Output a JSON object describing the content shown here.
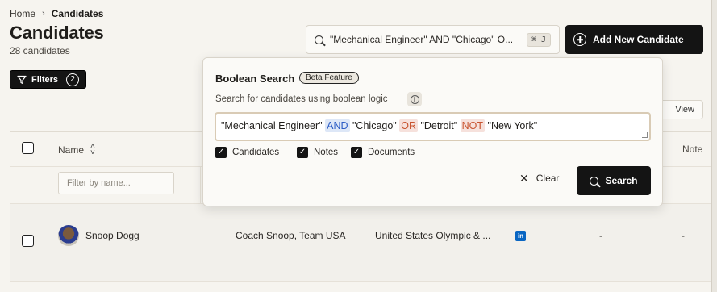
{
  "breadcrumb": {
    "home": "Home",
    "current": "Candidates"
  },
  "page": {
    "title": "Candidates",
    "count": "28 candidates"
  },
  "filters": {
    "label": "Filters",
    "badge": "2"
  },
  "search": {
    "query_preview": "\"Mechanical Engineer\" AND \"Chicago\" O...",
    "shortcut": "⌘ J"
  },
  "add_button": {
    "label": "Add New Candidate"
  },
  "view_button": {
    "label": "View"
  },
  "table": {
    "columns": {
      "name": "Name",
      "notes": "Note"
    },
    "filter_placeholder": "Filter by name...",
    "rows": [
      {
        "name": "Snoop Dogg",
        "title": "Coach Snoop, Team USA",
        "company": "United States Olympic & ...",
        "linkedin": "in",
        "col5": "-",
        "col6": "-"
      }
    ]
  },
  "boolean_search": {
    "title": "Boolean Search",
    "badge": "Beta Feature",
    "description": "Search for candidates using boolean logic",
    "tokens": {
      "t1": "\"Mechanical Engineer\"",
      "and": "AND",
      "t2": "\"Chicago\"",
      "or": "OR",
      "t3": "\"Detroit\"",
      "not": "NOT",
      "t4": "\"New York\""
    },
    "options": [
      "Candidates",
      "Notes",
      "Documents"
    ],
    "clear_label": "Clear",
    "search_label": "Search"
  },
  "colors": {
    "accent_dark": "#141414",
    "and_token": "#2a5bc5",
    "or_not_token": "#c8532f",
    "linkedin": "#0a66c2"
  }
}
